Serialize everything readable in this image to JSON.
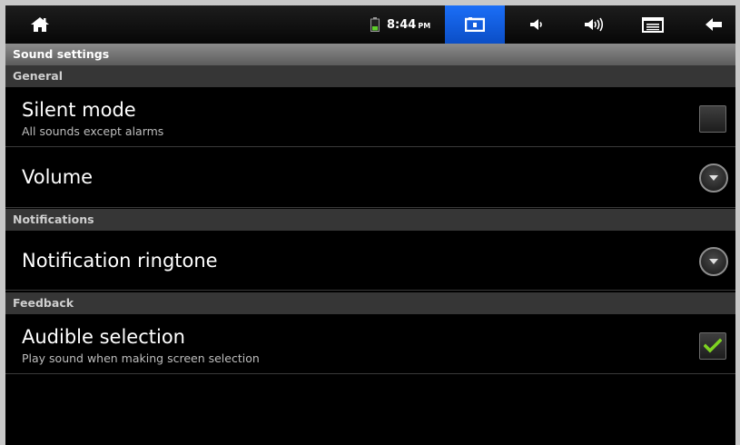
{
  "status_bar": {
    "time": "8:44",
    "ampm": "PM",
    "icons": [
      "home-icon",
      "battery-icon",
      "screenshot-icon",
      "volume-down-icon",
      "volume-up-icon",
      "menu-icon",
      "back-icon"
    ],
    "highlight_color": "#1565e8",
    "battery_color": "#5fcf2a"
  },
  "title": "Sound settings",
  "sections": {
    "general": "General",
    "notifications": "Notifications",
    "feedback": "Feedback"
  },
  "prefs": {
    "silent_mode": {
      "title": "Silent mode",
      "summary": "All sounds except alarms",
      "checked": false
    },
    "volume": {
      "title": "Volume"
    },
    "notification_ringtone": {
      "title": "Notification ringtone"
    },
    "audible_selection": {
      "title": "Audible selection",
      "summary": "Play sound when making screen selection",
      "checked": true
    }
  },
  "colors": {
    "check_mark": "#7ed321",
    "section_header": "#363636",
    "title_bar": "#777777"
  }
}
